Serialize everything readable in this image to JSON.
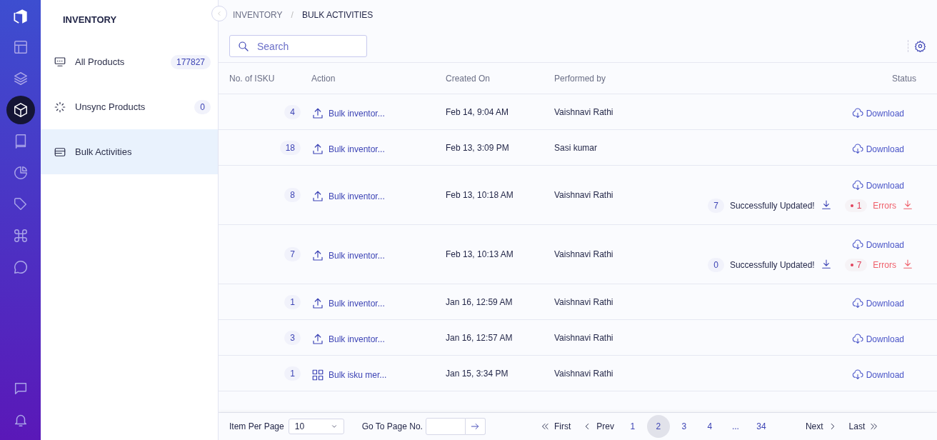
{
  "rail": [
    {
      "selected": false
    },
    {
      "selected": false
    },
    {
      "selected": true
    },
    {
      "selected": false
    },
    {
      "selected": false
    },
    {
      "selected": false
    },
    {
      "selected": false
    },
    {
      "selected": false
    },
    {
      "selected": false
    }
  ],
  "sidebar": {
    "title": "INVENTORY",
    "items": [
      {
        "label": "All Products",
        "count": "177827",
        "selected": false
      },
      {
        "label": "Unsync Products",
        "count": "0",
        "selected": false
      },
      {
        "label": "Bulk Activities",
        "selected": true
      }
    ]
  },
  "breadcrumb": {
    "separator": "/",
    "items": [
      "INVENTORY",
      "BULK ACTIVITIES"
    ]
  },
  "search": {
    "placeholder": "Search"
  },
  "table": {
    "columns": [
      "No. of ISKU",
      "Action",
      "Created On",
      "Performed by",
      "Status"
    ],
    "rows": [
      {
        "count": "4",
        "kind": "upload",
        "action": "Bulk inventor...",
        "created": "Feb 14, 9:04 AM",
        "performer": "Vaishnavi Rathi",
        "download": "Download"
      },
      {
        "count": "18",
        "kind": "upload",
        "action": "Bulk inventor...",
        "created": "Feb 13, 3:09 PM",
        "performer": "Sasi kumar",
        "download": "Download"
      },
      {
        "count": "8",
        "kind": "upload",
        "action": "Bulk inventor...",
        "created": "Feb 13, 10:18 AM",
        "performer": "Vaishnavi Rathi",
        "download": "Download",
        "result": {
          "success_count": "7",
          "success_label": "Successfully Updated!",
          "error_count": "1",
          "error_label": "Errors"
        }
      },
      {
        "count": "7",
        "kind": "upload",
        "action": "Bulk inventor...",
        "created": "Feb 13, 10:13 AM",
        "performer": "Vaishnavi Rathi",
        "download": "Download",
        "result": {
          "success_count": "0",
          "success_label": "Successfully Updated!",
          "error_count": "7",
          "error_label": "Errors"
        }
      },
      {
        "count": "1",
        "kind": "upload",
        "action": "Bulk inventor...",
        "created": "Jan 16, 12:59 AM",
        "performer": "Vaishnavi Rathi",
        "download": "Download"
      },
      {
        "count": "3",
        "kind": "upload",
        "action": "Bulk inventor...",
        "created": "Jan 16, 12:57 AM",
        "performer": "Vaishnavi Rathi",
        "download": "Download"
      },
      {
        "count": "1",
        "kind": "merge",
        "action": "Bulk isku mer...",
        "created": "Jan 15, 3:34 PM",
        "performer": "Vaishnavi Rathi",
        "download": "Download"
      }
    ]
  },
  "footer": {
    "per_page_label": "Item Per Page",
    "per_page": "10",
    "goto_label": "Go To Page No.",
    "first": "First",
    "prev": "Prev",
    "pages": [
      {
        "label": "1",
        "selected": false
      },
      {
        "label": "2",
        "selected": true
      },
      {
        "label": "3",
        "selected": false
      },
      {
        "label": "4",
        "selected": false
      },
      {
        "label": "...",
        "selected": false
      },
      {
        "label": "34",
        "selected": false
      }
    ],
    "next": "Next",
    "last": "Last"
  }
}
